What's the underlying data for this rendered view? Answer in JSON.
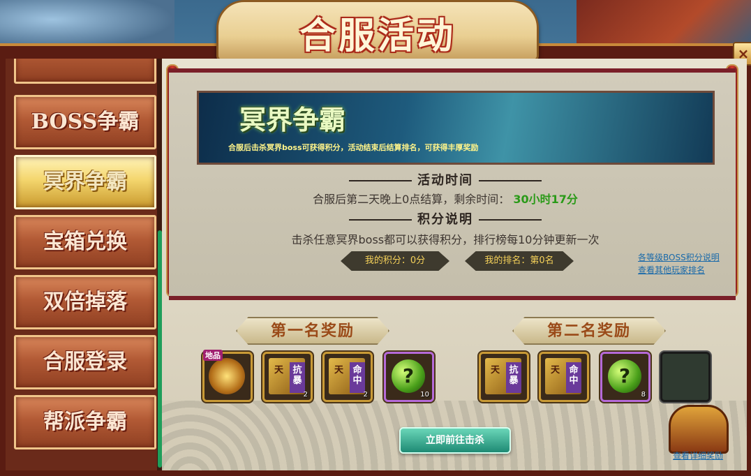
{
  "window": {
    "title": "合服活动",
    "close_label": "×"
  },
  "sidebar": {
    "items": [
      {
        "label": "BOSS争霸"
      },
      {
        "label": "冥界争霸",
        "active": true
      },
      {
        "label": "宝箱兑换"
      },
      {
        "label": "双倍掉落"
      },
      {
        "label": "合服登录"
      },
      {
        "label": "帮派争霸"
      }
    ]
  },
  "banner": {
    "title": "冥界争霸",
    "description": "合服后击杀冥界boss可获得积分，活动结束后结算排名，可获得丰厚奖励"
  },
  "activity_time": {
    "heading": "活动时间",
    "text": "合服后第二天晚上0点结算，剩余时间：",
    "remaining": "30小时17分"
  },
  "score_info": {
    "heading": "积分说明",
    "text": "击杀任意冥界boss都可以获得积分，排行榜每10分钟更新一次"
  },
  "stats": {
    "my_score": "我的积分：0分",
    "my_rank": "我的排名：第0名"
  },
  "links": {
    "boss_score_info": "各等级BOSS积分说明",
    "other_rankings": "查看其他玩家排名",
    "detailed_rewards": "查看详细奖励"
  },
  "rewards": {
    "first_title": "第一名奖励",
    "second_title": "第二名奖励",
    "first_items": [
      {
        "type": "gold",
        "tag": "地品",
        "count": ""
      },
      {
        "type": "book",
        "tian": "天",
        "label": "抗暴",
        "count": "2"
      },
      {
        "type": "book",
        "tian": "天",
        "label": "命中",
        "count": "2"
      },
      {
        "type": "orb",
        "symbol": "?",
        "count": "10"
      }
    ],
    "second_items": [
      {
        "type": "book",
        "tian": "天",
        "label": "抗暴",
        "count": ""
      },
      {
        "type": "book",
        "tian": "天",
        "label": "命中",
        "count": ""
      },
      {
        "type": "orb",
        "symbol": "?",
        "count": "8"
      },
      {
        "type": "empty",
        "count": ""
      }
    ]
  },
  "action_button": "立即前往击杀",
  "colors": {
    "accent": "#c1361f",
    "time_green": "#2a9a18",
    "link_blue": "#1a6aaa",
    "score_gold": "#f6d25a"
  }
}
